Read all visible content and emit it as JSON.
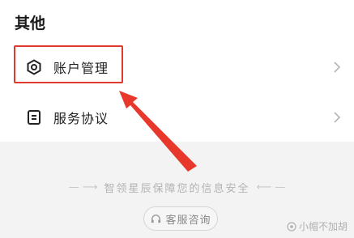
{
  "section": {
    "title": "其他"
  },
  "rows": [
    {
      "label": "账户管理",
      "icon": "hexagon-settings-icon"
    },
    {
      "label": "服务协议",
      "icon": "document-icon"
    }
  ],
  "security_note": {
    "text": "智领星辰保障您的信息安全"
  },
  "service_button": {
    "label": "客服咨询",
    "icon": "headset-icon"
  },
  "watermark": {
    "text": "小帽不加胡"
  },
  "colors": {
    "highlight": "#e03a2e",
    "background": "#f3f3f3",
    "card": "#ffffff"
  }
}
